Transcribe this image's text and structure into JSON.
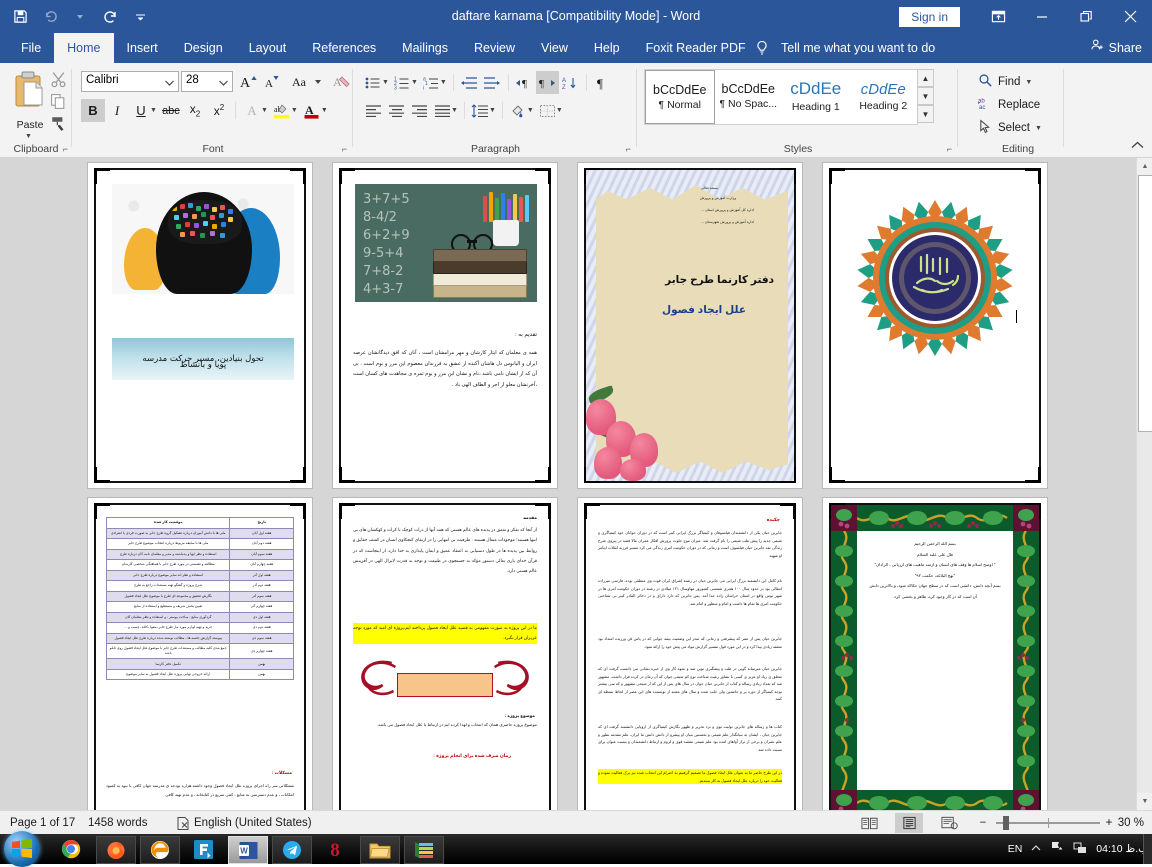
{
  "titlebar": {
    "document_title": "daftare karnama [Compatibility Mode]  -  Word",
    "sign_in": "Sign in",
    "qat": [
      "save-icon",
      "undo-icon",
      "redo-icon",
      "customize-qat-icon"
    ],
    "window_buttons": [
      "ribbon-display-options",
      "minimize",
      "restore",
      "close"
    ]
  },
  "tabs": [
    {
      "label": "File",
      "active": false
    },
    {
      "label": "Home",
      "active": true
    },
    {
      "label": "Insert",
      "active": false
    },
    {
      "label": "Design",
      "active": false
    },
    {
      "label": "Layout",
      "active": false
    },
    {
      "label": "References",
      "active": false
    },
    {
      "label": "Mailings",
      "active": false
    },
    {
      "label": "Review",
      "active": false
    },
    {
      "label": "View",
      "active": false
    },
    {
      "label": "Help",
      "active": false
    },
    {
      "label": "Foxit Reader PDF",
      "active": false
    }
  ],
  "tellme": "Tell me what you want to do",
  "share": "Share",
  "ribbon": {
    "clipboard": {
      "label": "Clipboard",
      "paste": "Paste",
      "buttons": [
        "cut-icon",
        "copy-icon",
        "format-painter-icon"
      ]
    },
    "font": {
      "label": "Font",
      "font_name": "Calibri",
      "font_size": "28",
      "row1": [
        "grow-font",
        "shrink-font",
        "change-case",
        "clear-formatting"
      ],
      "row2": [
        "bold",
        "italic",
        "underline",
        "strikethrough",
        "subscript",
        "superscript",
        "text-effects",
        "text-highlight-color",
        "font-color"
      ],
      "bold_active": true
    },
    "paragraph": {
      "label": "Paragraph",
      "row1": [
        "bullets",
        "numbering",
        "multilevel-list",
        "decrease-indent",
        "increase-indent",
        "ltr-text-direction",
        "rtl-text-direction",
        "sort",
        "show-formatting-marks"
      ],
      "row2": [
        "align-left",
        "center",
        "align-right",
        "justify",
        "line-spacing",
        "shading",
        "borders"
      ],
      "rtl_active": true
    },
    "styles": {
      "label": "Styles",
      "items": [
        {
          "preview": "bCcDdEe",
          "name": "¶ Normal",
          "selected": true
        },
        {
          "preview": "bCcDdEe",
          "name": "¶ No Spac...",
          "selected": false
        },
        {
          "preview": "cDdEe",
          "name": "Heading 1",
          "selected": false
        },
        {
          "preview": "cDdEe",
          "name": "Heading 2",
          "selected": false
        }
      ]
    },
    "editing": {
      "label": "Editing",
      "find": "Find",
      "replace": "Replace",
      "select": "Select"
    }
  },
  "document": {
    "pages": [
      {
        "number": 1,
        "kind": "cover-brain",
        "title_lines": [
          "تحول بنیادین، مسیر حرکت مدرسه",
          "پویا و بانشاط"
        ]
      },
      {
        "number": 2,
        "kind": "dedication",
        "heading": "تقدیم به :",
        "body": "همه ی معلمان که ایثار کارشان و مهر مرامشان است ، آنان که افق دیدگانشان عرصه ایران و الیانوس دل هاشان آکنده از عشق به فرزندان معصوم این مرز و بوم است . بی آن که از ایشان نامی باشد ،نام و نشان این مرز و بوم ثمره ی مجاهدت های کسان است ،آخرتشان معلو از اجر و الطاف الهی باد .",
        "chalkboard_equations": [
          "3+7+5",
          "8-4/2",
          "6+2+9",
          "9-5+4",
          "7+8-2",
          "4+3-7"
        ]
      },
      {
        "number": 3,
        "kind": "project-cover",
        "header_lines": [
          "بسمه تعالی",
          "وزارت آموزش و پرورش",
          "اداره کل آموزش و پرورش استان ...",
          "اداره آموزش و پرورش شهرستان ..."
        ],
        "title": "دفتر کارنما طرح جابر",
        "subtitle": "علل ایجاد فصول"
      },
      {
        "number": 4,
        "kind": "bismillah-medallion",
        "calligraphy": "بسم الله الرحمن الرحیم"
      },
      {
        "number": 5,
        "kind": "work-log-table",
        "columns": [
          "موقعیت کار شده",
          "تاریخ"
        ],
        "rows": [
          [
            "ملی ها با دانش آموزان درباره تشکیل گروه طرح جابر به صورت فردی یا انفرادی",
            "هفته اول آبان"
          ],
          [
            "ملی ها با سلیقه مربوط درباره انتخاب موضوع طرح جابر",
            "هفته دوم آبان"
          ],
          [
            "استفاده و نظر ایها و پدماشنه و مدیر و معلمان نامه کان درباره طرح",
            "هفته سوم آبان"
          ],
          [
            "مطالعه و نشستی در مورد طرح جابر با هماهنگی شخصی کارشان",
            "هفته چهارم آبان"
          ],
          [
            "استفاده و نظر اند سایر موضوع درباره طرح جابر",
            "هفته اول آذر"
          ],
          [
            "شرح پروژه و گفتگو تهیه مستندات راجع به طرح",
            "هفته دوم آذر"
          ],
          [
            "نگارش تحقیق و مجموعه ای طرح با موضوع علل ایجاد فصول",
            "هفته سوم آذر"
          ],
          [
            "تعیین بخش شریف و مستطیع و استفاده از منابع",
            "هفته چهارم آذر"
          ],
          [
            "گردآوری منابع ، ساخت پوستر ، و استفاده و نظر معلمان کان",
            "هفته اول دی"
          ],
          [
            "خرید و تهیه لوازم مورد نیاز طرح جابر ،مقوا ،کاغذ ،چسب و ...",
            "هفته دوم دی"
          ],
          [
            "پیوسته گزارش جلسه ها ، مطالب نوشته شده درباره طرح علل ایجاد فصول",
            "هفته سوم دی"
          ],
          [
            "جمع بندی کلیه مطالب و مستندات طرح جابر با موضوع علل ایجاد فصول روی تابلو باشد",
            "هفته چهارم دی"
          ],
          [
            "تکمیل دفتر کارنما",
            "بهمن"
          ],
          [
            "ارائه خروجی نهایی پروژه علل ایجاد فصول به سایر موضوع",
            "بهمن"
          ]
        ],
        "note_heading": "مشکلات :",
        "note_body": "مشکلاتی سر راه اجرای پروژه علل ایجاد فصول وجود داشته هزاره بودجه ی مدرسه جهان کافی با نبود به کمبود امکانات ، و عدم دسترسی به منابع ، کمی سریع در کتابخانه ، و عدم تهیه کافی"
      },
      {
        "number": 6,
        "kind": "abstract",
        "heading": "مقدمه",
        "body": "از آنجا که تفکر و تعمق در پدیده های عالم هستی که همه آنها از ذرات کوچک تا کرات و کهکشان های بی انتها هستند؛ موجودات متعال هستند . ظرفیت بی انتهایی را در ارتقای کنجکاوی انسان در کشف حقایق و روابط بین پدیده ها در طول دستیابی به اعتقاد عمیق و ایمان پایداری به خدا دارد. از اینجاست که در قرآن خدای یاری تعالی دستور مؤکد به جستجوی در طبیعت و توجه به قدرت لایزال الهی در آفرینش عالم هستی دارد.",
        "highlight": "ما در این پروژه به صورت مفهومی به قضیه علل ایجاد فصول پرداخته ایم،پروژه ای امید که مورد توجه عزیزان قرار بگیرد.",
        "topic_label": "موضوع پروژه :",
        "topic_body": "موضوع پروژه حاضری همان که انتخاب و لهذا کرده ایم در ارتباط با علل ایجاد فصول می باشد.",
        "time_label": "زمان صرف شده برای انجام پروژه :"
      },
      {
        "number": 7,
        "kind": "summary",
        "heading": "چکیده",
        "paragraphs": [
          "جابربن حیان یکی از دانشمندان فیلسوفان و کیمیاگر بزرگ ایرانی کبیر است که در دوران جوانان خود کیمیاگری و شیمی جدید را پیش طب شیمی را نام گرفت شد. میزان موج جلوت پرورش افکار عمران مالا قصد در پیروی شرح زندگی نقد جابربن حیان فیلسوف است و زمانی که در دوران حکومت امری زندگی می کرد مسیر فرزند انقلاب اینامر او شهید.",
          "نام کامل این دانشمند بزرگ ایرانی می جابربن حیان در رشته اشراق ایران قوت وی منطقی بوده، فارسی میرزاده انتقالی بود در حدود سال ١٠٠ هجری شمسی کشورور مهاوسال ١٢١ میلادی در رشته در دوران حکومت امری ها در شهر توس واقع در استان خراسان زاده خدا آمد. پس جابربن که دارد دارای و در ذخائر القادر کبیر بی شناختی حکومت امری ها تمام ها داشت و امام و منظور و امام شد.",
          "جابربن حیان پس از عمر که پیشرفتی و زمانی که تبحر این وضعیت نیمه جوانی که در پاس فن ورزیده امتداد بود معتقد زیادی پیدا کرد و در این مورد قول تفسیر گزارش مواد می پیش خود را ارائه نمود.",
          "جابربن حیان میرساند گویی در طب و پیشگیری نوین شد و نحوه کار وی از خیره نشانی می دانست گرفت ای که متعلق ی زیاد او عزیز ی کسی با نشاور رغبت شناخت نوع کم شیمی جوان که آن زمان در کرده قرار داشت، مشهور شد که تعداد زیادی رساله و کتاب از جابربن حیان جوان در سال های پس از این که از شیخی مشهور و که سی بیشتر توجه کیمیاگر از دوره پر و جانشین ولی جلب شده و سال های معتبد از نویسنده های این عصر از لحاظ بسطه ای کنند.",
          "کتاب ها و رساله های جابربن تولیت بوی و نزد تحریر و ظهور نگارش کیمیاگری از اروپایی دانشمند گرفت ای که جابربن حیان ، ایشان به بنیانگذار علم شیمی و نخستین بنیان او پیشرو از دانش دانش ما ایران، علم مقدمه تطور و علم عمران و برخی از تراز آواهای امده بود علم شیمی مقصد قوی و لزوم و ارتباط دانشمندان و بیست عنوان برای نسبت داده شد."
        ],
        "highlight": "در این طرح حاضر ما به عنوان علل ایجاد فصول ما تصمیم گرفتیم به احترام این انتخاب شده نیز برک فعالیت نموده و فعالیت خود را درباره علل ایجاد فصول به کار بببندیم."
      },
      {
        "number": 8,
        "kind": "framed-quote",
        "lines": [
          "بسم الله الرحمن الرحیم",
          "قال علی علیه السلام",
          "\" اوضح اسلام ها وقف های انسان و ازمند ماهیت های ارزیابی ، الرادان\"",
          "\"نهج البلاغه، حکمت ٩٢\"",
          "بسم آنچه دانش، دانشی است که در سطح جهان حکاکه شود، و بالاترین دانش",
          "آن است که در کار وجود کرد، ظاهر و بخشی کرد."
        ]
      }
    ]
  },
  "status": {
    "page": "Page 1 of 17",
    "words": "1458 words",
    "proofing": "proofing-errors-icon",
    "language": "English (United States)",
    "views": [
      "read-mode-icon",
      "print-layout-icon",
      "web-layout-icon"
    ],
    "zoom": "30 %",
    "zoom_out": "−",
    "zoom_in": "+"
  },
  "taskbar": {
    "start": "start-orb",
    "items": [
      "chrome-icon",
      "firefox-icon",
      "edge-icon",
      "foxit-reader-icon",
      "word-icon",
      "telegram-icon",
      "eight-app-icon",
      "file-explorer-icon",
      "winrar-icon"
    ],
    "tray": {
      "language": "EN",
      "time": "04:10 ب.ظ",
      "icons": [
        "show-hidden-icons",
        "flag-action-center-icon",
        "network-icon"
      ]
    }
  }
}
